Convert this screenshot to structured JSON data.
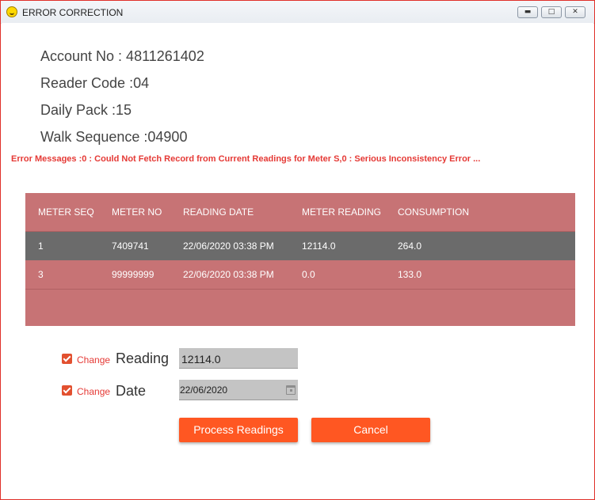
{
  "window": {
    "title": "ERROR CORRECTION",
    "minimize_icon": "minimize-icon",
    "maximize_icon": "maximize-icon",
    "close_icon": "close-icon"
  },
  "info": {
    "account": "Account No : 4811261402",
    "reader_code": "Reader Code :04",
    "daily_pack": "Daily Pack :15",
    "walk_sequence": "Walk Sequence :04900"
  },
  "error_message": "Error Messages :0 : Could Not Fetch Record from Current Readings for Meter S,0 : Serious Inconsistency Error ...",
  "table": {
    "headers": [
      "METER SEQ",
      "METER NO",
      "READING DATE",
      "METER READING",
      "CONSUMPTION"
    ],
    "rows": [
      [
        "1",
        "7409741",
        "22/06/2020 03:38 PM",
        "12114.0",
        "264.0"
      ],
      [
        "3",
        "99999999",
        "22/06/2020 03:38 PM",
        "0.0",
        "133.0"
      ]
    ],
    "selected_row": 0
  },
  "form": {
    "reading": {
      "checkbox_label": "Change",
      "label": "Reading",
      "value": "12114.0",
      "checked": true
    },
    "date": {
      "checkbox_label": "Change",
      "label": "Date",
      "value": "22/06/2020",
      "checked": true,
      "icon": "calendar-icon"
    }
  },
  "buttons": {
    "process": "Process Readings",
    "cancel": "Cancel"
  },
  "colors": {
    "accent": "#ff5722",
    "error": "#e53935",
    "grid_bg": "#c77375",
    "selected_row": "#6b6b6b"
  }
}
